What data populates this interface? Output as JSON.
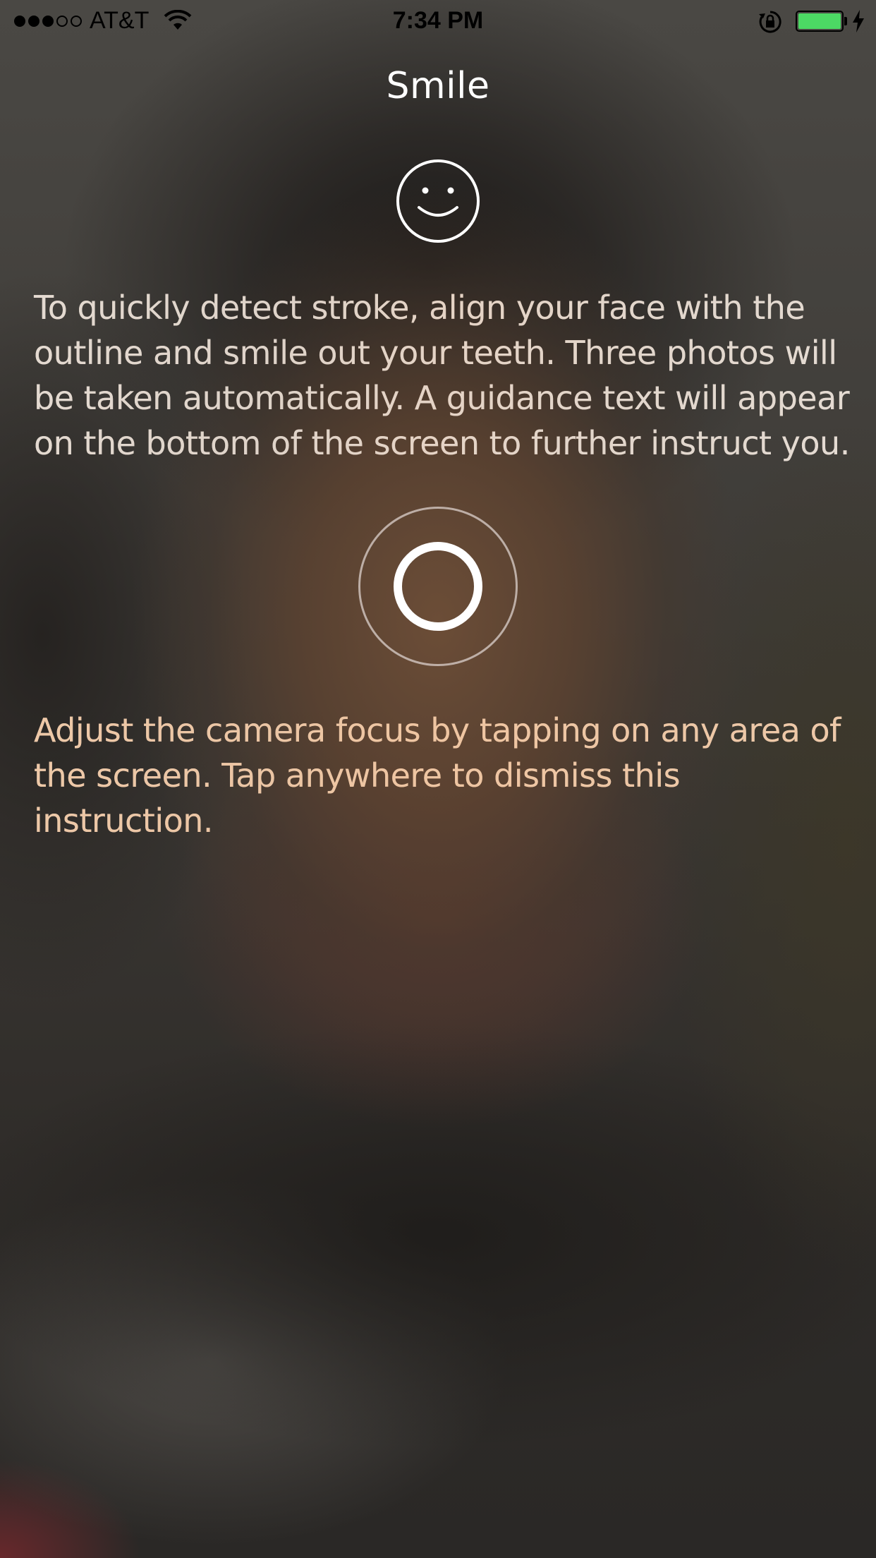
{
  "status_bar": {
    "signal_bars": {
      "filled": 3,
      "total": 5
    },
    "carrier": "AT&T",
    "time": "7:34 PM",
    "battery_color": "#4cd964"
  },
  "header": {
    "title": "Smile"
  },
  "icons": {
    "face": "smile-icon",
    "capture": "shutter-icon"
  },
  "instructions": {
    "main": "To quickly detect stroke, align your face with the outline and smile out your teeth. Three photos will be taken automatically. A guidance text will appear on the bottom of the screen to further instruct you.",
    "secondary": "Adjust the camera focus by tapping on any area of the screen. Tap anywhere to dismiss this instruction."
  }
}
